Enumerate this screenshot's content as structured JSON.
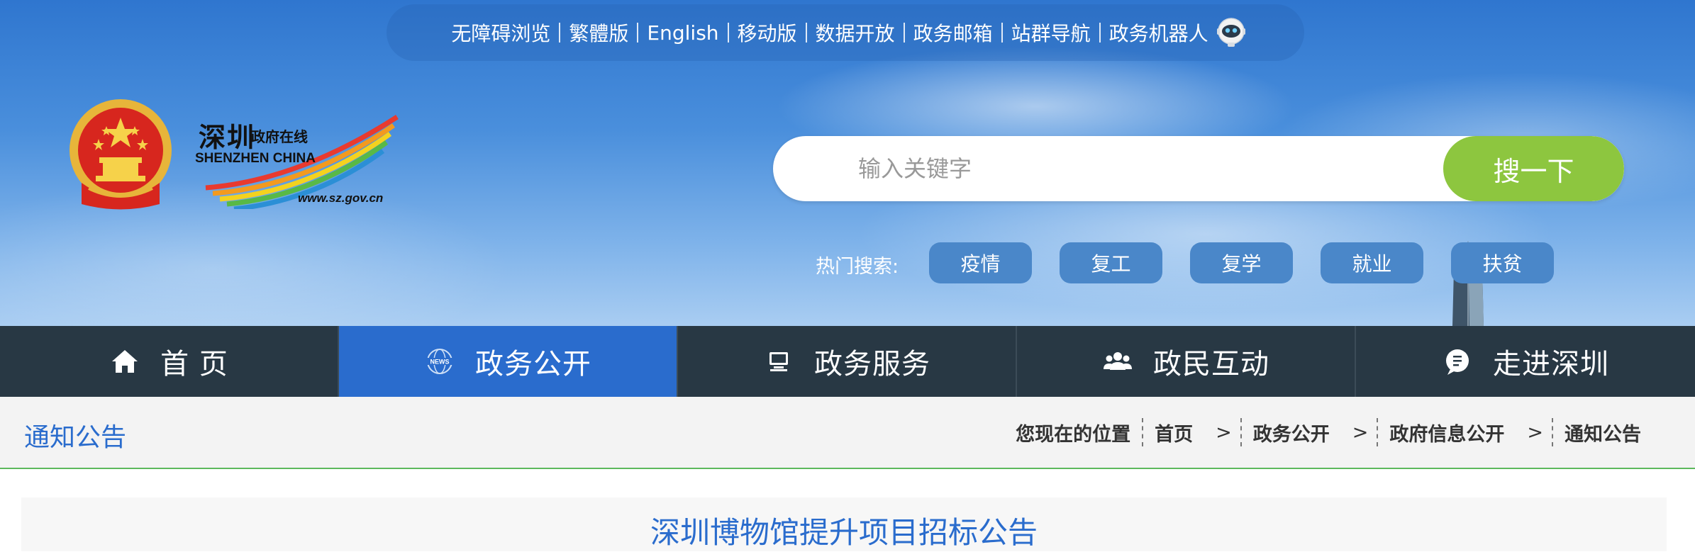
{
  "top_links": [
    "无障碍浏览",
    "繁體版",
    "English",
    "移动版",
    "数据开放",
    "政务邮箱",
    "站群导航",
    "政务机器人"
  ],
  "logo": {
    "cn_big": "深圳",
    "cn_small": "政府在线",
    "en": "SHENZHEN  CHINA",
    "url": "www.sz.gov.cn"
  },
  "search": {
    "placeholder": "输入关键字",
    "button": "搜一下"
  },
  "hot_search": {
    "label": "热门搜索:",
    "tags": [
      "疫情",
      "复工",
      "复学",
      "就业",
      "扶贫"
    ]
  },
  "nav": [
    {
      "label": "首 页",
      "icon": "home-icon",
      "active": false
    },
    {
      "label": "政务公开",
      "icon": "news-icon",
      "active": true
    },
    {
      "label": "政务服务",
      "icon": "computer-icon",
      "active": false
    },
    {
      "label": "政民互动",
      "icon": "people-icon",
      "active": false
    },
    {
      "label": "走进深圳",
      "icon": "chat-bubble-icon",
      "active": false
    }
  ],
  "section_title": "通知公告",
  "breadcrumb": {
    "prefix": "您现在的位置",
    "items": [
      "首页",
      "政务公开",
      "政府信息公开",
      "通知公告"
    ]
  },
  "article": {
    "title": "深圳博物馆提升项目招标公告"
  },
  "colors": {
    "nav_bg": "#283844",
    "nav_active": "#2a6ccd",
    "search_button": "#8dc63f",
    "accent_blue": "#2a6ccd",
    "divider_green": "#5cb85c"
  }
}
